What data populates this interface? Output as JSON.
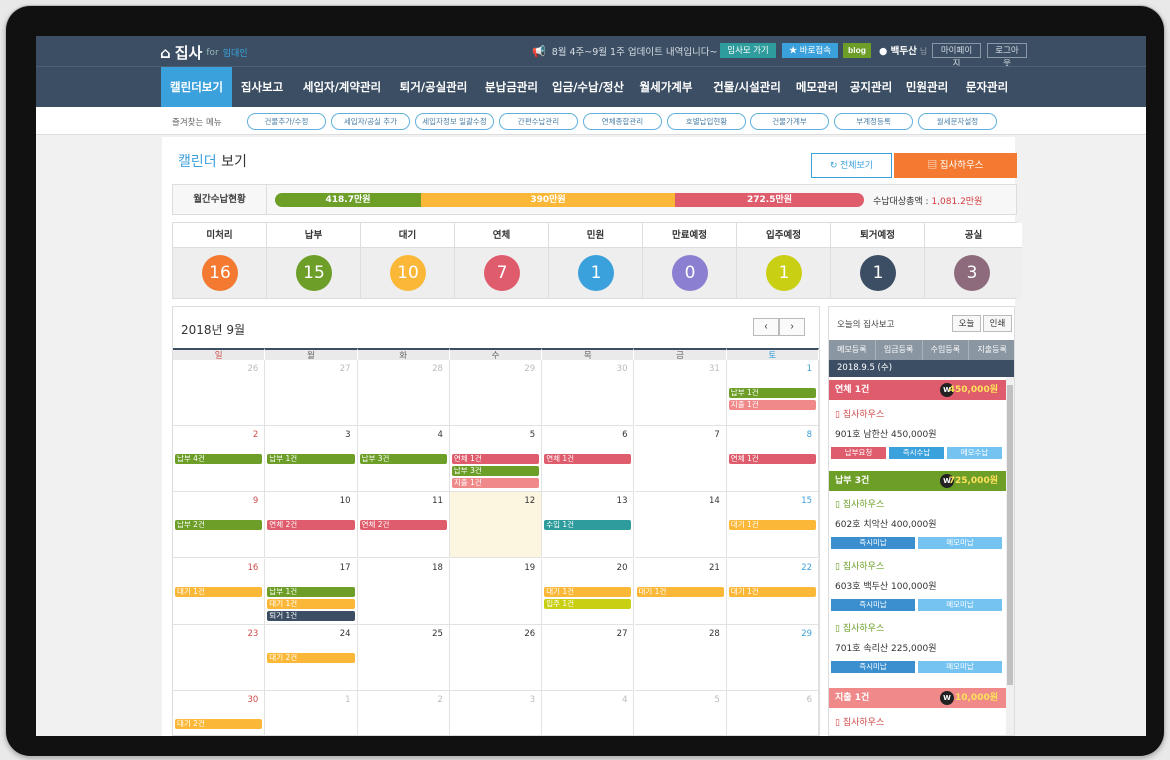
{
  "header": {
    "logo": "집사",
    "logo_for": "for",
    "logo_sub": "임대인",
    "notice": "8월 4주~9월 1주 업데이트 내역입니다~",
    "btn_go": "임사모 가기",
    "btn_quick": "★ 바로접속",
    "btn_blog": "blog",
    "user": "백두산",
    "user_suffix": "님",
    "mypage": "마이페이지",
    "logout": "로그아웃"
  },
  "nav": [
    "캘린더보기",
    "집사보고",
    "세입자/계약관리",
    "퇴거/공실관리",
    "분납금관리",
    "입금/수납/정산",
    "월세가계부",
    "건물/시설관리",
    "메모관리",
    "공지관리",
    "민원관리",
    "문자관리"
  ],
  "favorites": {
    "label": "즐겨찾는 메뉴",
    "items": [
      "건물추가/수정",
      "세입자/공실 추가",
      "세입자정보 일괄수정",
      "간편수납관리",
      "연체종합관리",
      "호별납입현황",
      "건물가계부",
      "부계정등록",
      "월세문자설정"
    ]
  },
  "page": {
    "title_a": "캘린더",
    "title_b": "보기",
    "btn_all": "전체보기",
    "btn_house": "집사하우스"
  },
  "summary": {
    "label": "월간수납현황",
    "bars": [
      {
        "text": "418.7만원",
        "color": "#6c9e28"
      },
      {
        "text": "390만원",
        "color": "#fbb838"
      },
      {
        "text": "272.5만원",
        "color": "#df5c6c"
      }
    ],
    "total_label": "수납대상총액 :",
    "total_value": "1,081.2만원"
  },
  "stats": [
    {
      "label": "미처리",
      "value": "16",
      "color": "#f47a32"
    },
    {
      "label": "납부",
      "value": "15",
      "color": "#6c9e28"
    },
    {
      "label": "대기",
      "value": "10",
      "color": "#fbb838"
    },
    {
      "label": "연체",
      "value": "7",
      "color": "#df5c6c"
    },
    {
      "label": "민원",
      "value": "1",
      "color": "#3ba1dd"
    },
    {
      "label": "만료예정",
      "value": "0",
      "color": "#8a7fd1"
    },
    {
      "label": "입주예정",
      "value": "1",
      "color": "#c9cf13"
    },
    {
      "label": "퇴거예정",
      "value": "1",
      "color": "#3b4e63"
    },
    {
      "label": "공실",
      "value": "3",
      "color": "#8d6b7c"
    }
  ],
  "calendar": {
    "title": "2018년 9월",
    "prev": "‹",
    "next": "›",
    "weekdays": [
      "일",
      "월",
      "화",
      "수",
      "목",
      "금",
      "토"
    ],
    "weeks": [
      [
        {
          "d": "26",
          "o": true
        },
        {
          "d": "27",
          "o": true
        },
        {
          "d": "28",
          "o": true
        },
        {
          "d": "29",
          "o": true
        },
        {
          "d": "30",
          "o": true
        },
        {
          "d": "31",
          "o": true
        },
        {
          "d": "1",
          "ev": [
            [
              "납부 1건",
              "#6c9e28"
            ],
            [
              "지출 1건",
              "#f08a8a"
            ]
          ]
        }
      ],
      [
        {
          "d": "2",
          "ev": [
            [
              "납부 4건",
              "#6c9e28"
            ]
          ]
        },
        {
          "d": "3",
          "ev": [
            [
              "납부 1건",
              "#6c9e28"
            ]
          ]
        },
        {
          "d": "4",
          "ev": [
            [
              "납부 3건",
              "#6c9e28"
            ]
          ]
        },
        {
          "d": "5",
          "ev": [
            [
              "연체 1건",
              "#df5c6c"
            ],
            [
              "납부 3건",
              "#6c9e28"
            ],
            [
              "지출 1건",
              "#f08a8a"
            ]
          ]
        },
        {
          "d": "6",
          "ev": [
            [
              "연체 1건",
              "#df5c6c"
            ]
          ]
        },
        {
          "d": "7"
        },
        {
          "d": "8",
          "ev": [
            [
              "연체 1건",
              "#df5c6c"
            ]
          ]
        }
      ],
      [
        {
          "d": "9",
          "ev": [
            [
              "납부 2건",
              "#6c9e28"
            ]
          ]
        },
        {
          "d": "10",
          "ev": [
            [
              "연체 2건",
              "#df5c6c"
            ]
          ]
        },
        {
          "d": "11",
          "ev": [
            [
              "연체 2건",
              "#df5c6c"
            ]
          ]
        },
        {
          "d": "12",
          "today": true
        },
        {
          "d": "13",
          "ev": [
            [
              "수입 1건",
              "#2e9c9c"
            ]
          ]
        },
        {
          "d": "14"
        },
        {
          "d": "15",
          "ev": [
            [
              "대기 1건",
              "#fbb838"
            ]
          ]
        }
      ],
      [
        {
          "d": "16",
          "ev": [
            [
              "대기 1건",
              "#fbb838"
            ]
          ]
        },
        {
          "d": "17",
          "ev": [
            [
              "납부 1건",
              "#6c9e28"
            ],
            [
              "대기 1건",
              "#fbb838"
            ],
            [
              "퇴거 1건",
              "#3b4e63"
            ]
          ]
        },
        {
          "d": "18"
        },
        {
          "d": "19"
        },
        {
          "d": "20",
          "ev": [
            [
              "대기 1건",
              "#fbb838"
            ],
            [
              "입주 1건",
              "#c9cf13"
            ]
          ]
        },
        {
          "d": "21",
          "ev": [
            [
              "대기 1건",
              "#fbb838"
            ]
          ]
        },
        {
          "d": "22",
          "ev": [
            [
              "대기 1건",
              "#fbb838"
            ]
          ]
        }
      ],
      [
        {
          "d": "23"
        },
        {
          "d": "24",
          "ev": [
            [
              "대기 2건",
              "#fbb838"
            ]
          ]
        },
        {
          "d": "25"
        },
        {
          "d": "26"
        },
        {
          "d": "27"
        },
        {
          "d": "28"
        },
        {
          "d": "29"
        }
      ],
      [
        {
          "d": "30",
          "ev": [
            [
              "대기 2건",
              "#fbb838"
            ]
          ]
        },
        {
          "d": "1",
          "o": true
        },
        {
          "d": "2",
          "o": true
        },
        {
          "d": "3",
          "o": true
        },
        {
          "d": "4",
          "o": true
        },
        {
          "d": "5",
          "o": true
        },
        {
          "d": "6",
          "o": true
        }
      ]
    ]
  },
  "side": {
    "title": "오늘의 집사보고",
    "btn_today": "오늘",
    "btn_print": "인쇄",
    "tabs": [
      "메모등록",
      "입금등록",
      "수입등록",
      "지출등록"
    ],
    "date": "2018.9.5 (수)",
    "groups": [
      {
        "label": "연체 1건",
        "amount": "450,000원",
        "color": "#df5c6c"
      },
      {
        "label": "납부 3건",
        "amount": "725,000원",
        "color": "#6c9e28"
      },
      {
        "label": "지출 1건",
        "amount": "10,000원",
        "color": "#f08a8a"
      }
    ],
    "entries": [
      {
        "house": "집사하우스",
        "line": "901호 남한산 450,000원",
        "tags": [
          [
            "납부요청",
            "#df5c6c"
          ],
          [
            "즉시수납",
            "#3ba1dd"
          ],
          [
            "메모수납",
            "#74c3f0"
          ]
        ]
      },
      {
        "house": "집사하우스",
        "line": "602호 치악산 400,000원",
        "tags": [
          [
            "즉시미납",
            "#3b8fcf"
          ],
          [
            "메모미납",
            "#74c3f0"
          ]
        ]
      },
      {
        "house": "집사하우스",
        "line": "603호 백두산 100,000원",
        "tags": [
          [
            "즉시미납",
            "#3b8fcf"
          ],
          [
            "메모미납",
            "#74c3f0"
          ]
        ]
      },
      {
        "house": "집사하우스",
        "line": "701호 속리산 225,000원",
        "tags": [
          [
            "즉시미납",
            "#3b8fcf"
          ],
          [
            "메모미납",
            "#74c3f0"
          ]
        ]
      },
      {
        "house": "집사하우스",
        "line": "",
        "tags": []
      }
    ],
    "w_label": "W"
  }
}
